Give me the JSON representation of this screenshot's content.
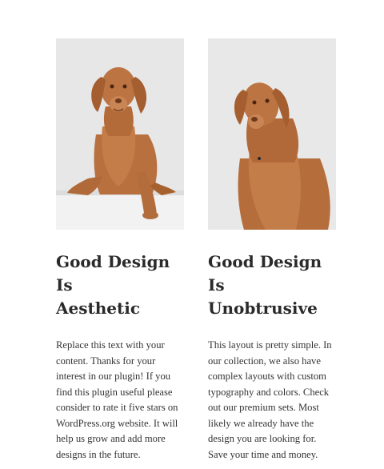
{
  "cards": [
    {
      "image_alt": "vizsla-dog-lying-photo",
      "title_line1": "Good Design Is",
      "title_line2": "Aesthetic",
      "text_lines": [
        "Replace this text with your",
        "content. Thanks for your",
        "interest in our plugin! If you",
        "find this plugin useful please",
        "consider to rate it five stars on",
        "WordPress.org website. It will",
        "help us grow and add more",
        "designs in the future."
      ]
    },
    {
      "image_alt": "vizsla-dog-sitting-photo",
      "title_line1": "Good Design Is",
      "title_line2": "Unobtrusive",
      "text_lines": [
        "This layout is pretty simple. In",
        "our collection, we also have",
        "complex layouts with custom",
        "typography and colors. Check",
        "out our premium sets. Most",
        "likely we already have the",
        "design you are looking for.",
        "Save your time and money."
      ]
    }
  ],
  "colors": {
    "photo_bg": "#e6e6e6",
    "dog": "#b8703f",
    "dog_shadow": "#94552b",
    "text": "#333333"
  }
}
